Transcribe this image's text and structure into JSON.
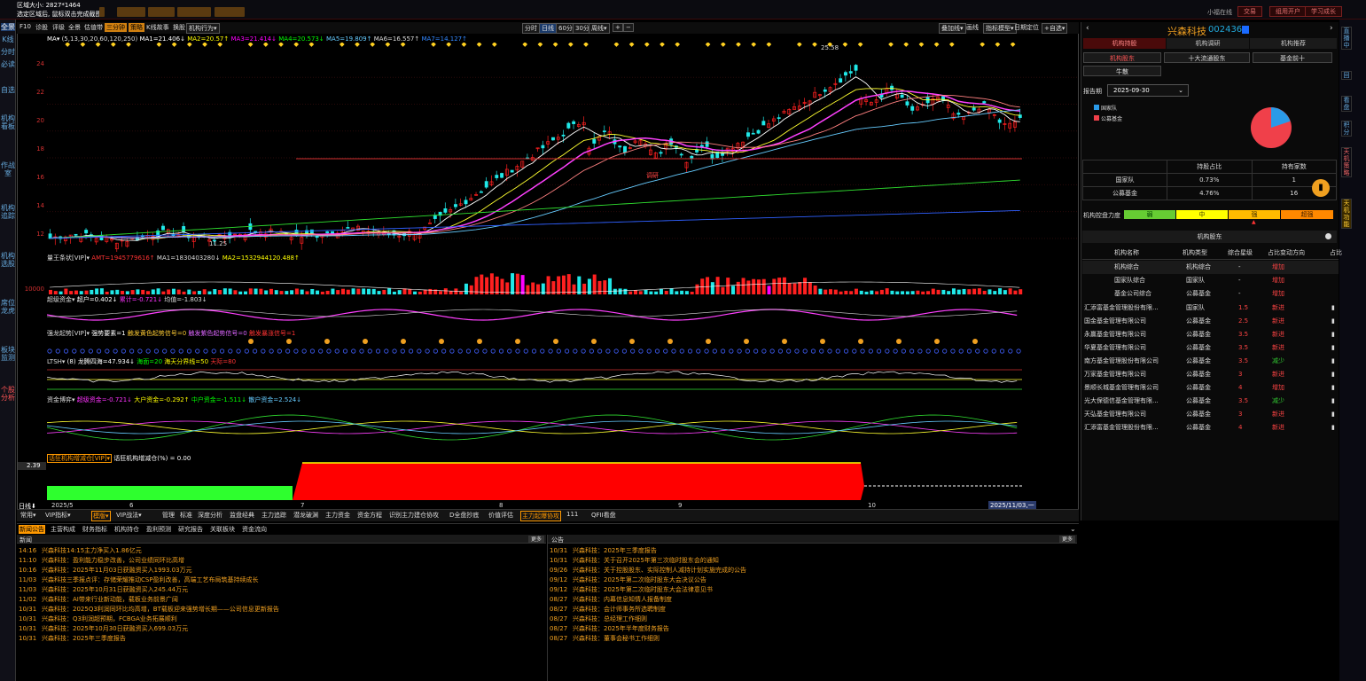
{
  "topbar": {
    "region_size": "区域大小: 2827*1464",
    "hint": "选定区域后, 鼠标双击完成截图",
    "btns": [
      "",
      "",
      "",
      "",
      ""
    ],
    "right": [
      "小福在线",
      "交易",
      "组用开户",
      "学习成长"
    ]
  },
  "left_tabs": [
    "全景",
    "K线",
    "分时",
    "必读",
    "自选",
    "机构看板",
    "作战室",
    "机构追踪",
    "机构选股",
    "席位龙虎",
    "板块监测",
    "个股分析"
  ],
  "right_tabs": [
    "直播中",
    "回",
    "看盘",
    "积分",
    "天机策略",
    "天机功能"
  ],
  "toolbar": {
    "items": [
      "F10",
      "诊股",
      "评级",
      "全景",
      "估值带"
    ],
    "active": "三分钟",
    "active2": "策略",
    "items2": [
      "K线故事",
      "换股",
      "机构行为▾"
    ],
    "periods": [
      "分时",
      "日线",
      "60分",
      "30分",
      "周线▾",
      "+",
      "−"
    ],
    "right": [
      "叠加线▾",
      "画线",
      "指标模型▾",
      "日期定位",
      "+自选▾"
    ]
  },
  "ma": {
    "label": "MA▾",
    "params": "(5,13,30,20,60,120,250)",
    "ma1": "MA1=21.406↓",
    "ma2": "MA2=20.57↑",
    "ma3": "MA3=21.414↓",
    "ma4": "MA4=20.573↓",
    "ma5": "MA5=19.809↑",
    "ma6": "MA6=16.557↑",
    "ma7": "MA7=14.127↑"
  },
  "price_axis": [
    "24",
    "22",
    "20",
    "18",
    "16",
    "14",
    "12"
  ],
  "annotations": {
    "high": "25.58",
    "low": "11.25",
    "tiao_mai": "调研",
    "hot": "热"
  },
  "vol": {
    "title": "量王条状[VIP]▾",
    "amt": "AMT=1945779616↑",
    "ma1": "MA1=1830403280↓",
    "ma2": "MA2=1532944120.488↑"
  },
  "vol_axis": "10000",
  "ind1": {
    "title": "超级资金▾",
    "a": "超户=0.402↓",
    "b": "累计=-0.721↓",
    "c": "均值=-1.803↓"
  },
  "ind2": {
    "title": "强龙起势[VIP]▾",
    "a": "强势要素=1",
    "b": "触发黄色起势信号=0",
    "c": "触发紫色起势信号=0",
    "d": "触发暴涨信号=1"
  },
  "ind3": {
    "title": "LTSH▾",
    "a": "(8) 龙腾四海=47.934↓",
    "b": "海面=20",
    "c": "海天分界线=50",
    "d": "天际=80"
  },
  "ind4": {
    "title": "资金博弈▾",
    "a": "超级资金=-0.721↓",
    "b": "大户资金=-0.292↑",
    "c": "中户资金=-1.511↓",
    "d": "散户资金=2.524↓"
  },
  "ind5": {
    "title": "话狂机构增减仓[VIP]▾",
    "b": "话狂机构增减仓(%) = 0.00",
    "value": "2.39"
  },
  "date_axis": [
    "日线⬇",
    "2025/5",
    "6",
    "7",
    "8",
    "9",
    "10",
    "2025/11/03,一"
  ],
  "bottom_tabs": [
    "常用▾",
    "VIP指标▾",
    "模版▾",
    "VIP战法▾",
    "管理",
    "标准",
    "深度分析",
    "监盘经典",
    "主力追踪",
    "潜龙破渊",
    "主力资金",
    "资金方程",
    "识别主力建仓协攻",
    "D全盘抄底",
    "价值评估",
    "主力起爆协攻",
    "111",
    "QFII看盘"
  ],
  "info_tabs": [
    "新闻公告",
    "主营构成",
    "财务指标",
    "机构持仓",
    "盈利预测",
    "研究报告",
    "关联板块",
    "资金流向"
  ],
  "news_head": "新闻",
  "ann_head": "公告",
  "more": "更多",
  "news": [
    [
      "14:16",
      "兴森科技14:15主力净买入1.86亿元"
    ],
    [
      "11:10",
      "兴森科技：盈利能力稳步改善，公司业绩同环比高增"
    ],
    [
      "10:16",
      "兴森科技：2025年11月03日获融资买入1993.03万元"
    ],
    [
      "11/03",
      "兴森科技三季报点评：存储荣耀推动CSP盈利改善，高端工艺布局筑基持续成长"
    ],
    [
      "11/03",
      "兴森科技：2025年10月31日获融资买入245.44万元"
    ],
    [
      "11/02",
      "兴森科技：AI带来行业新动能，载板业务前景广阔"
    ],
    [
      "10/31",
      "兴森科技：2025Q3利润同环比均高增，BT载板迎来强势增长期——公司信息更新报告"
    ],
    [
      "10/31",
      "兴森科技：Q3利润超预期，FCBGA业务拓展顺利"
    ],
    [
      "10/31",
      "兴森科技：2025年10月30日获融资买入699.03万元"
    ],
    [
      "10/31",
      "兴森科技：2025年三季度报告"
    ]
  ],
  "anns": [
    [
      "10/31",
      "兴森科技：2025年三季度报告"
    ],
    [
      "10/31",
      "兴森科技：关于召开2025年第三次临时股东会的通知"
    ],
    [
      "09/26",
      "兴森科技：关于控股股东、实际控制人减持计划实施完成的公告"
    ],
    [
      "09/12",
      "兴森科技：2025年第二次临时股东大会决议公告"
    ],
    [
      "09/12",
      "兴森科技：2025年第二次临时股东大会法律意见书"
    ],
    [
      "08/27",
      "兴森科技：内幕信息知情人报备制度"
    ],
    [
      "08/27",
      "兴森科技：会计师事务所选聘制度"
    ],
    [
      "08/27",
      "兴森科技：总经理工作细则"
    ],
    [
      "08/27",
      "兴森科技：2025年半年度财务报告"
    ],
    [
      "08/27",
      "兴森科技：董事会秘书工作细则"
    ]
  ],
  "rp": {
    "name": "兴森科技",
    "code": "002436",
    "tabs": [
      "机构持股",
      "机构调研",
      "机构推荐"
    ],
    "subtabs": [
      "机构股东",
      "十大流通股东",
      "基金前十",
      "牛散"
    ],
    "period_label": "报告期",
    "period": "2025-09-30",
    "legend": [
      "国家队",
      "公募基金"
    ],
    "table_head": [
      "",
      "持股占比",
      "持有家数"
    ],
    "table": [
      [
        "国家队",
        "0.73%",
        "1"
      ],
      [
        "公募基金",
        "4.76%",
        "16"
      ]
    ],
    "ctrl_label": "机构控盘力度",
    "ctrl": [
      "弱",
      "中",
      "强",
      "超强"
    ],
    "inst_title": "机构股东",
    "inst_head": [
      "机构名称",
      "机构类型",
      "综合星级",
      "占比变动方向",
      "占比"
    ],
    "summary": [
      [
        "机构综合",
        "机构综合",
        "-",
        "增加"
      ],
      [
        "国家队综合",
        "国家队",
        "-",
        "增加"
      ],
      [
        "基金公司综合",
        "公募基金",
        "-",
        "增加"
      ]
    ],
    "holders": [
      [
        "汇添富基金管理股份有限...",
        "国家队",
        "1.5",
        "新进"
      ],
      [
        "国金基金管理有限公司",
        "公募基金",
        "2.5",
        "新进"
      ],
      [
        "永赢基金管理有限公司",
        "公募基金",
        "3.5",
        "新进"
      ],
      [
        "华夏基金管理有限公司",
        "公募基金",
        "3.5",
        "新进"
      ],
      [
        "南方基金管理股份有限公司",
        "公募基金",
        "3.5",
        "减少"
      ],
      [
        "万家基金管理有限公司",
        "公募基金",
        "3",
        "新进"
      ],
      [
        "景顺长城基金管理有限公司",
        "公募基金",
        "4",
        "增加"
      ],
      [
        "光大保德信基金管理有限...",
        "公募基金",
        "3.5",
        "减少"
      ],
      [
        "天弘基金管理有限公司",
        "公募基金",
        "3",
        "新进"
      ],
      [
        "汇添富基金管理股份有限...",
        "公募基金",
        "4",
        "新进"
      ]
    ]
  },
  "colors": {
    "up": "#ff2020",
    "down": "#20e8e8",
    "orange": "#f0a020"
  }
}
